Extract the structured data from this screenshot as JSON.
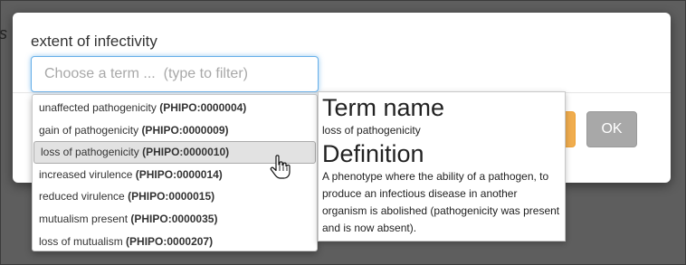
{
  "background": {
    "partial_text": "s"
  },
  "modal": {
    "label": "extent of infectivity",
    "input": {
      "value": "",
      "placeholder": "Choose a term ...  (type to filter)"
    },
    "ok_label": "OK"
  },
  "dropdown": {
    "options": [
      {
        "name": "unaffected pathogenicity",
        "code": "(PHIPO:0000004)"
      },
      {
        "name": "gain of pathogenicity",
        "code": "(PHIPO:0000009)"
      },
      {
        "name": "loss of pathogenicity",
        "code": "(PHIPO:0000010)"
      },
      {
        "name": "increased virulence",
        "code": "(PHIPO:0000014)"
      },
      {
        "name": "reduced virulence",
        "code": "(PHIPO:0000015)"
      },
      {
        "name": "mutualism present",
        "code": "(PHIPO:0000035)"
      },
      {
        "name": "loss of mutualism",
        "code": "(PHIPO:0000207)"
      }
    ],
    "highlighted_index": 2
  },
  "info": {
    "term_heading": "Term name",
    "term_value": "loss of pathogenicity",
    "def_heading": "Definition",
    "def_value": "A phenotype where the ability of a pathogen, to produce an infectious disease in another organism is abolished (pathogenicity was present and is now absent)."
  },
  "colors": {
    "input_focus": "#66afe9",
    "warning_button": "#f0ad4e",
    "ok_button": "#a8a8a8",
    "highlight_row": "#e2e2e2"
  },
  "icons": {
    "cursor": "hand-pointer-icon"
  }
}
